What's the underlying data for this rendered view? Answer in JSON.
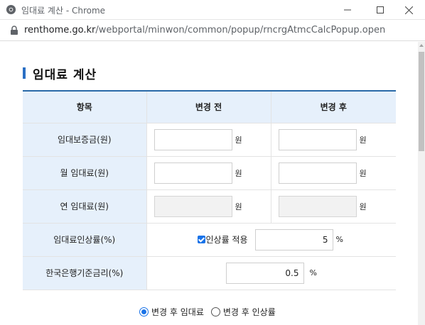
{
  "window": {
    "title": "임대료 계산 - Chrome",
    "url_host": "renthome.go.kr",
    "url_path": "/webportal/minwon/common/popup/rncrgAtmcCalcPopup.open"
  },
  "page": {
    "heading": "임대료 계산"
  },
  "table": {
    "headers": [
      "항목",
      "변경 전",
      "변경 후"
    ],
    "rows": [
      {
        "label": "임대보증금(원)",
        "before": "",
        "after": "",
        "unit": "원"
      },
      {
        "label": "월 임대료(원)",
        "before": "",
        "after": "",
        "unit": "원"
      },
      {
        "label": "연 임대료(원)",
        "before": "",
        "after": "",
        "unit": "원"
      }
    ],
    "rate_row": {
      "label": "임대료인상률(%)",
      "checkbox_label": "인상률 적용",
      "checked": true,
      "value": "5",
      "unit": "%"
    },
    "bok_row": {
      "label": "한국은행기준금리(%)",
      "value": "0.5",
      "unit": "%"
    }
  },
  "options": {
    "radio1": "변경 후 임대료",
    "radio2": "변경 후 인상률",
    "selected": "radio1"
  },
  "colors": {
    "accent": "#2a6fc4",
    "header_bg": "#e6f0fb",
    "check_blue": "#1a73e8"
  }
}
